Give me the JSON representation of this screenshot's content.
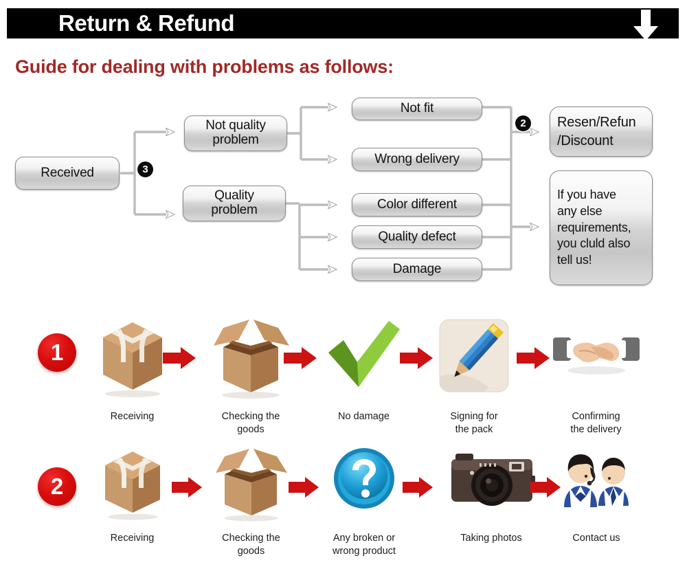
{
  "header": {
    "title": "Return & Refund",
    "down_arrow_icon": "down-arrow-icon",
    "bar_color": "#000000",
    "text_color": "#ffffff"
  },
  "guide": {
    "heading": "Guide for dealing with problems as follows:",
    "heading_color": "#a02a28"
  },
  "flowchart": {
    "nodes": {
      "received": "Received",
      "not_quality_problem": "Not quality\nproblem",
      "quality_problem": "Quality\nproblem",
      "not_fit": "Not fit",
      "wrong_delivery": "Wrong delivery",
      "color_different": "Color different",
      "quality_defect": "Quality defect",
      "damage": "Damage",
      "resend_refund_discount": "Resen/Refun\n/Discount",
      "any_else": "If you have\nany else\nrequirements,\nyou cluld also\ntell us!"
    },
    "badges": {
      "badge_three": "3",
      "badge_two": "2"
    },
    "box_fill": "#d6d6d6",
    "box_border": "#8d8d8d",
    "connector_color": "#b7b7b7"
  },
  "process": {
    "arrow_color": "#cc1212",
    "number_badge_color": "#d80d0d",
    "rows": [
      {
        "number": "1",
        "steps": [
          {
            "icon": "sealed-box-icon",
            "label": "Receiving"
          },
          {
            "icon": "open-box-icon",
            "label": "Checking the\ngoods"
          },
          {
            "icon": "green-check-icon",
            "label": "No damage"
          },
          {
            "icon": "pencil-sign-icon",
            "label": "Signing for\nthe pack"
          },
          {
            "icon": "handshake-icon",
            "label": "Confirming\nthe delivery"
          }
        ]
      },
      {
        "number": "2",
        "steps": [
          {
            "icon": "sealed-box-icon",
            "label": "Receiving"
          },
          {
            "icon": "open-box-icon",
            "label": "Checking the\ngoods"
          },
          {
            "icon": "question-mark-icon",
            "label": "Any broken or\nwrong product"
          },
          {
            "icon": "camera-icon",
            "label": "Taking photos"
          },
          {
            "icon": "support-agents-icon",
            "label": "Contact us"
          }
        ]
      }
    ]
  }
}
